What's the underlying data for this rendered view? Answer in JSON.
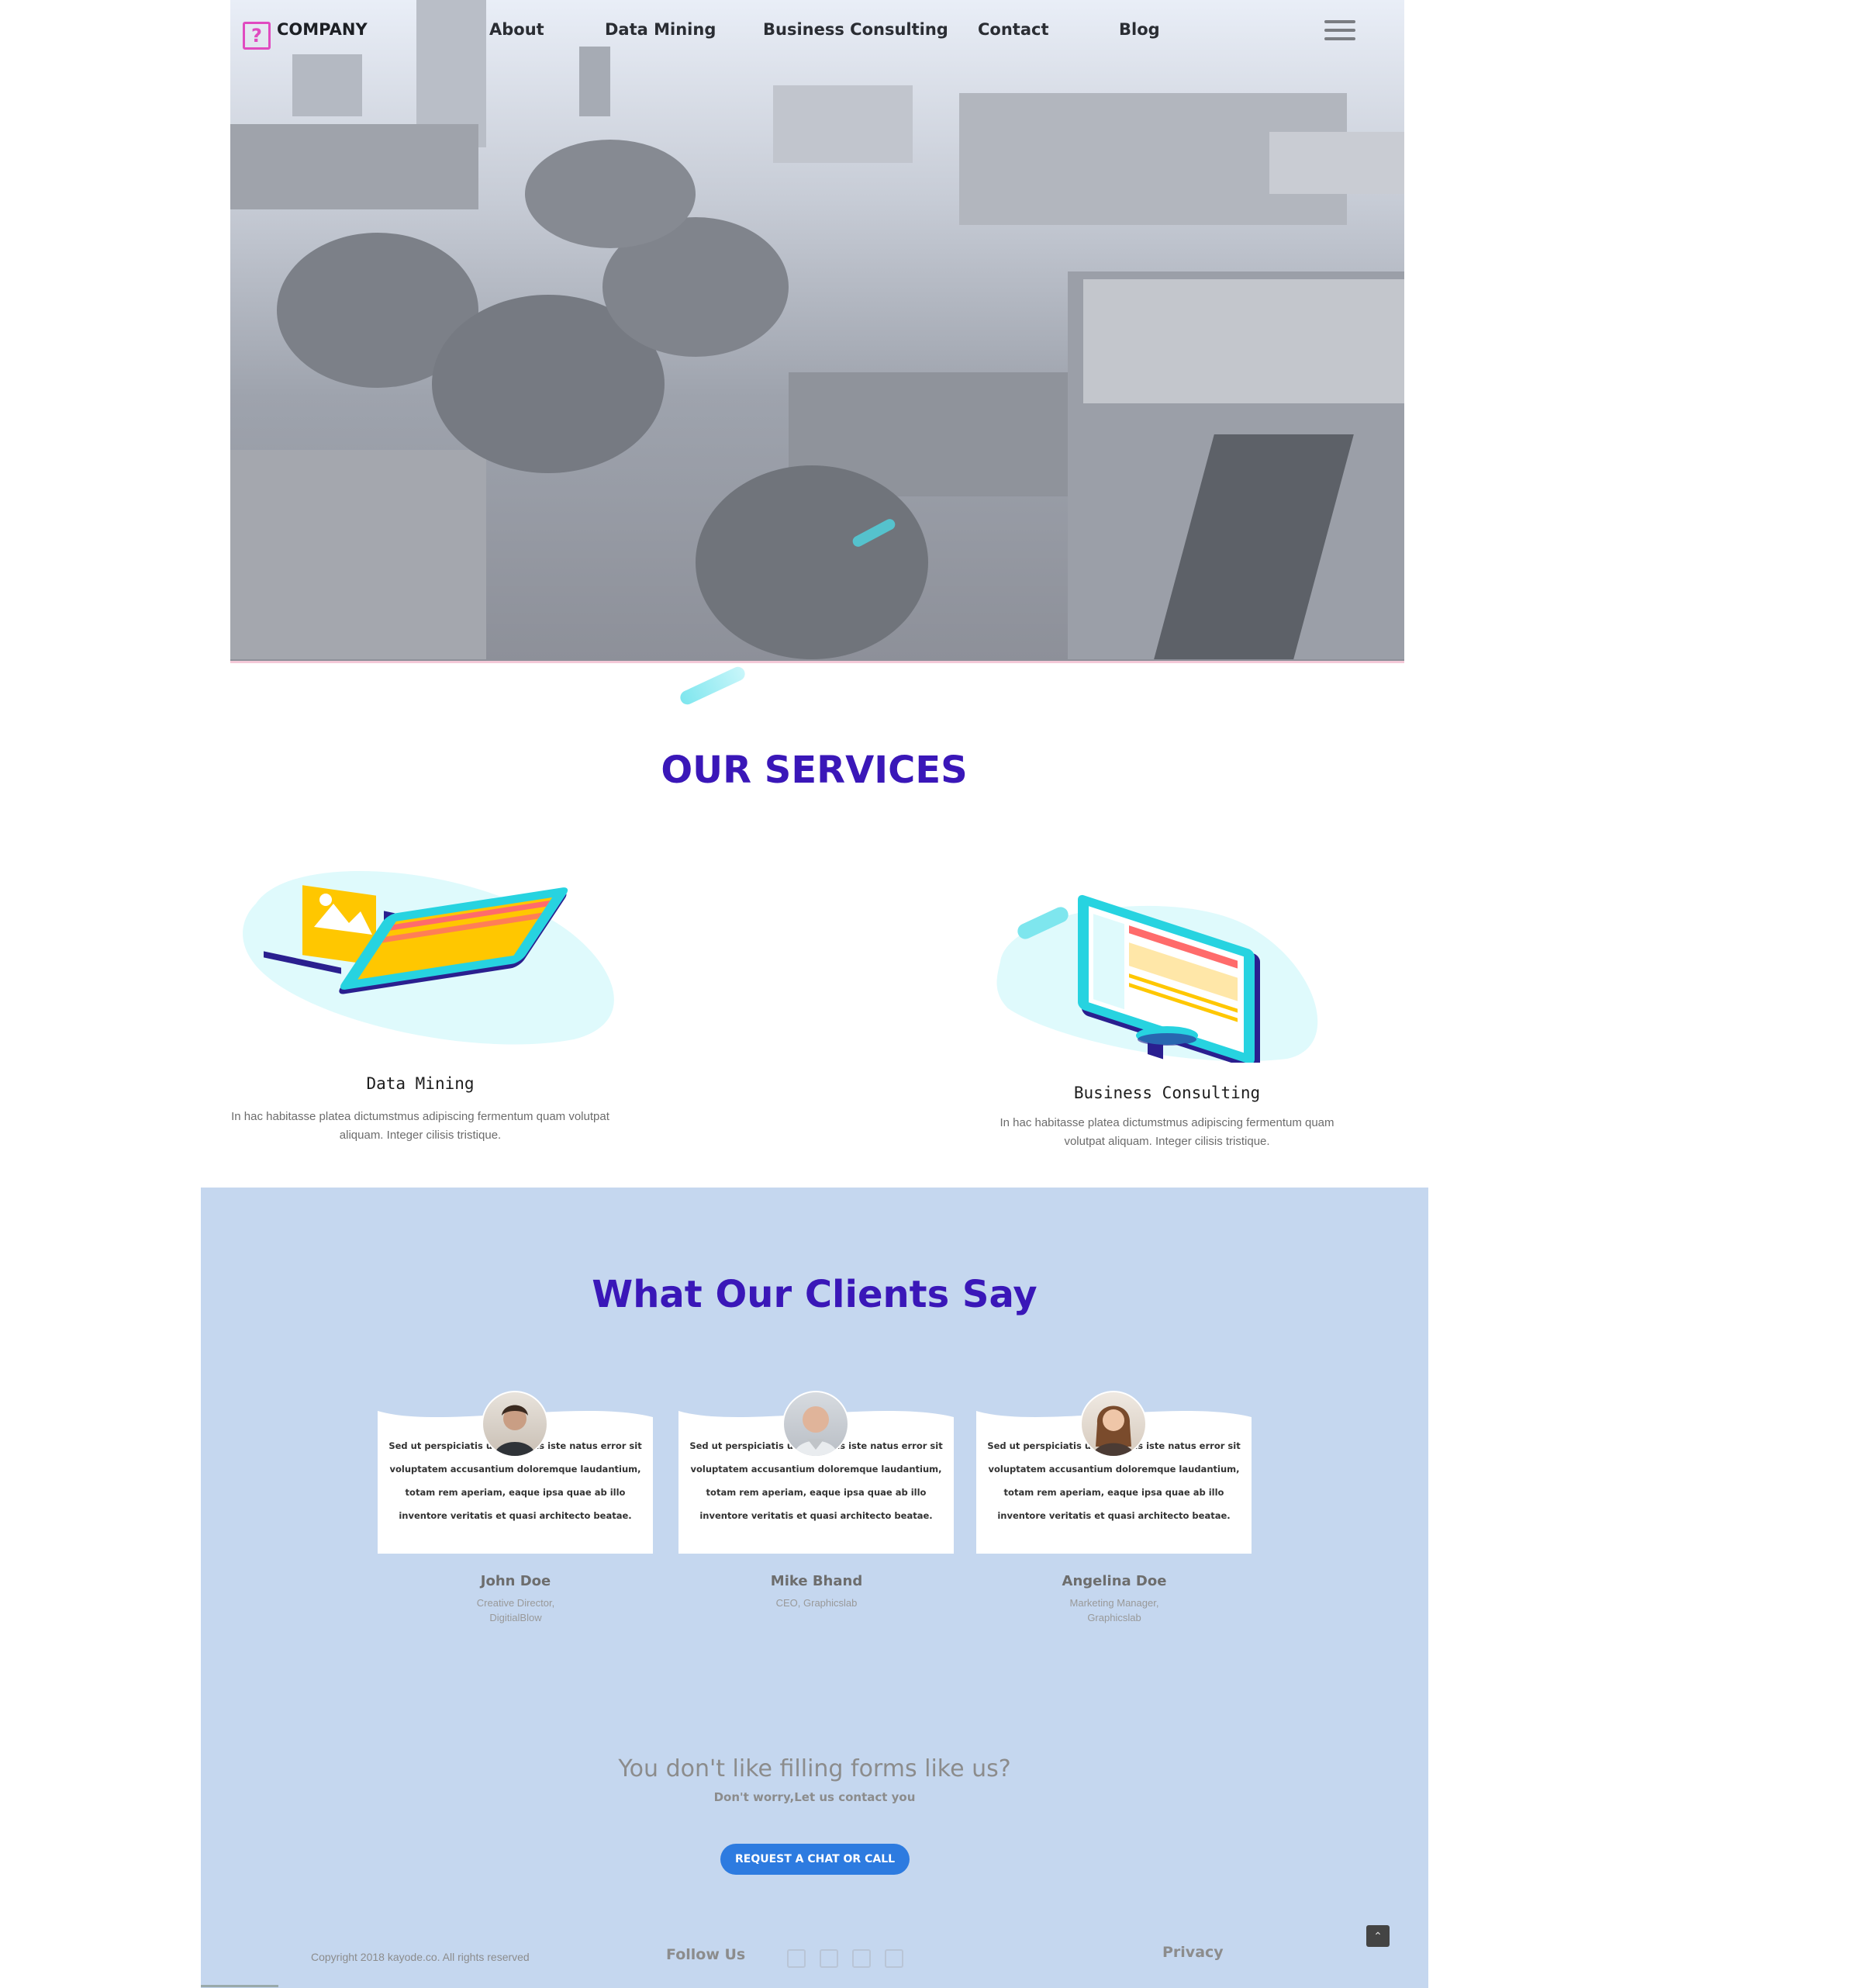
{
  "nav": {
    "brand": "COMPANY",
    "links": [
      "About",
      "Data Mining",
      "Business Consulting",
      "Contact",
      "Blog"
    ]
  },
  "services": {
    "title": "OUR SERVICES",
    "items": [
      {
        "name": "Data Mining",
        "description": "In hac habitasse platea dictumstmus adipiscing fermentum quam volutpat aliquam. Integer cilisis tristique."
      },
      {
        "name": "Business Consulting",
        "description": "In hac habitasse platea dictumstmus adipiscing fermentum quam volutpat aliquam. Integer cilisis tristique."
      }
    ]
  },
  "clients": {
    "title": "What Our Clients Say",
    "testimonials": [
      {
        "text": "Sed ut perspiciatis unde omnis iste natus error sit voluptatem accusantium doloremque laudantium, totam rem aperiam, eaque ipsa quae ab illo inventore veritatis et quasi architecto beatae.",
        "name": "John Doe",
        "role": "Creative Director, DigitialBlow"
      },
      {
        "text": "Sed ut perspiciatis unde omnis iste natus error sit voluptatem accusantium doloremque laudantium, totam rem aperiam, eaque ipsa quae ab illo inventore veritatis et quasi architecto beatae.",
        "name": "Mike Bhand",
        "role": "CEO, Graphicslab"
      },
      {
        "text": "Sed ut perspiciatis unde omnis iste natus error sit voluptatem accusantium doloremque laudantium, totam rem aperiam, eaque ipsa quae ab illo inventore veritatis et quasi architecto beatae.",
        "name": "Angelina Doe",
        "role": "Marketing Manager, Graphicslab"
      }
    ]
  },
  "cta": {
    "title": "You don't like filling forms like us?",
    "subtitle": "Don't worry,Let us contact you",
    "button": "REQUEST A CHAT OR CALL"
  },
  "footer": {
    "copyright": "Copyright 2018 kayode.co. All rights reserved",
    "follow": "Follow Us",
    "privacy": "Privacy",
    "back_to_top_icon": "chevron-up-icon"
  },
  "colors": {
    "accent": "#3a17b8",
    "logo": "#e04bc0",
    "button": "#2d7be0",
    "clients_bg": "#c5d7ef",
    "illustration_cyan": "#27d3e0",
    "illustration_yellow": "#ffc700"
  }
}
